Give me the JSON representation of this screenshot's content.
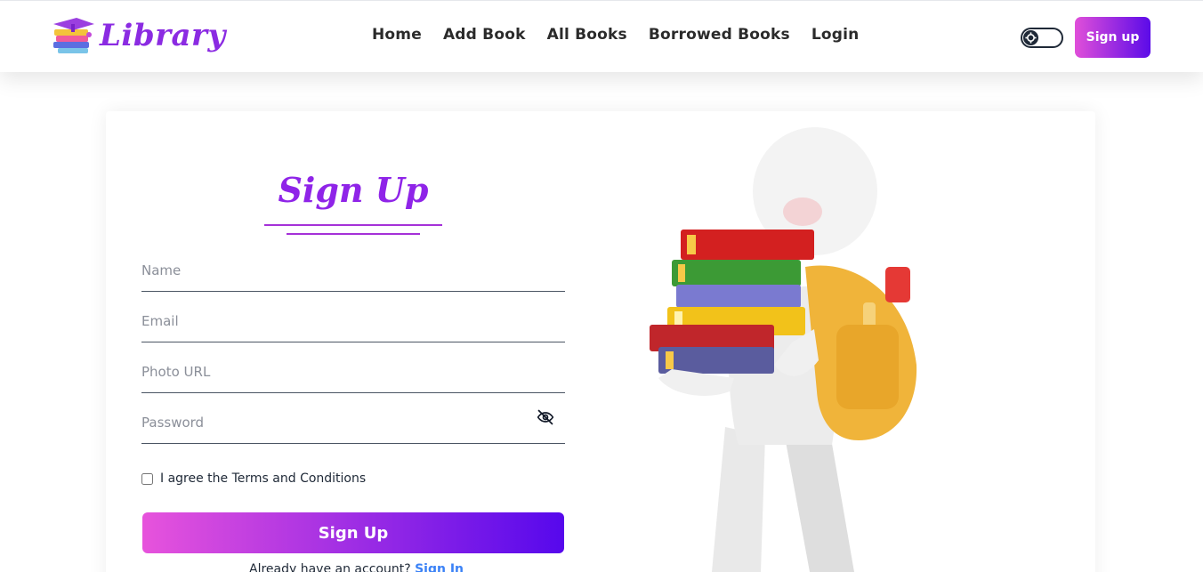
{
  "header": {
    "brand": "Library",
    "nav": [
      "Home",
      "Add Book",
      "All Books",
      "Borrowed Books",
      "Login"
    ],
    "signup_button": "Sign up",
    "theme_toggle_icon": "gear-icon"
  },
  "form": {
    "title": "Sign Up",
    "fields": {
      "name": {
        "placeholder": "Name",
        "value": ""
      },
      "email": {
        "placeholder": "Email",
        "value": ""
      },
      "photo": {
        "placeholder": "Photo URL",
        "value": ""
      },
      "password": {
        "placeholder": "Password",
        "value": ""
      }
    },
    "terms_label": "I agree the Terms and Conditions",
    "submit_label": "Sign Up",
    "signin_prompt": "Already have an account?",
    "signin_link": "Sign In"
  },
  "colors": {
    "brand": "#8b2be2",
    "gradient_start": "#e753dc",
    "gradient_end": "#5608ec",
    "link": "#3b82f6"
  }
}
